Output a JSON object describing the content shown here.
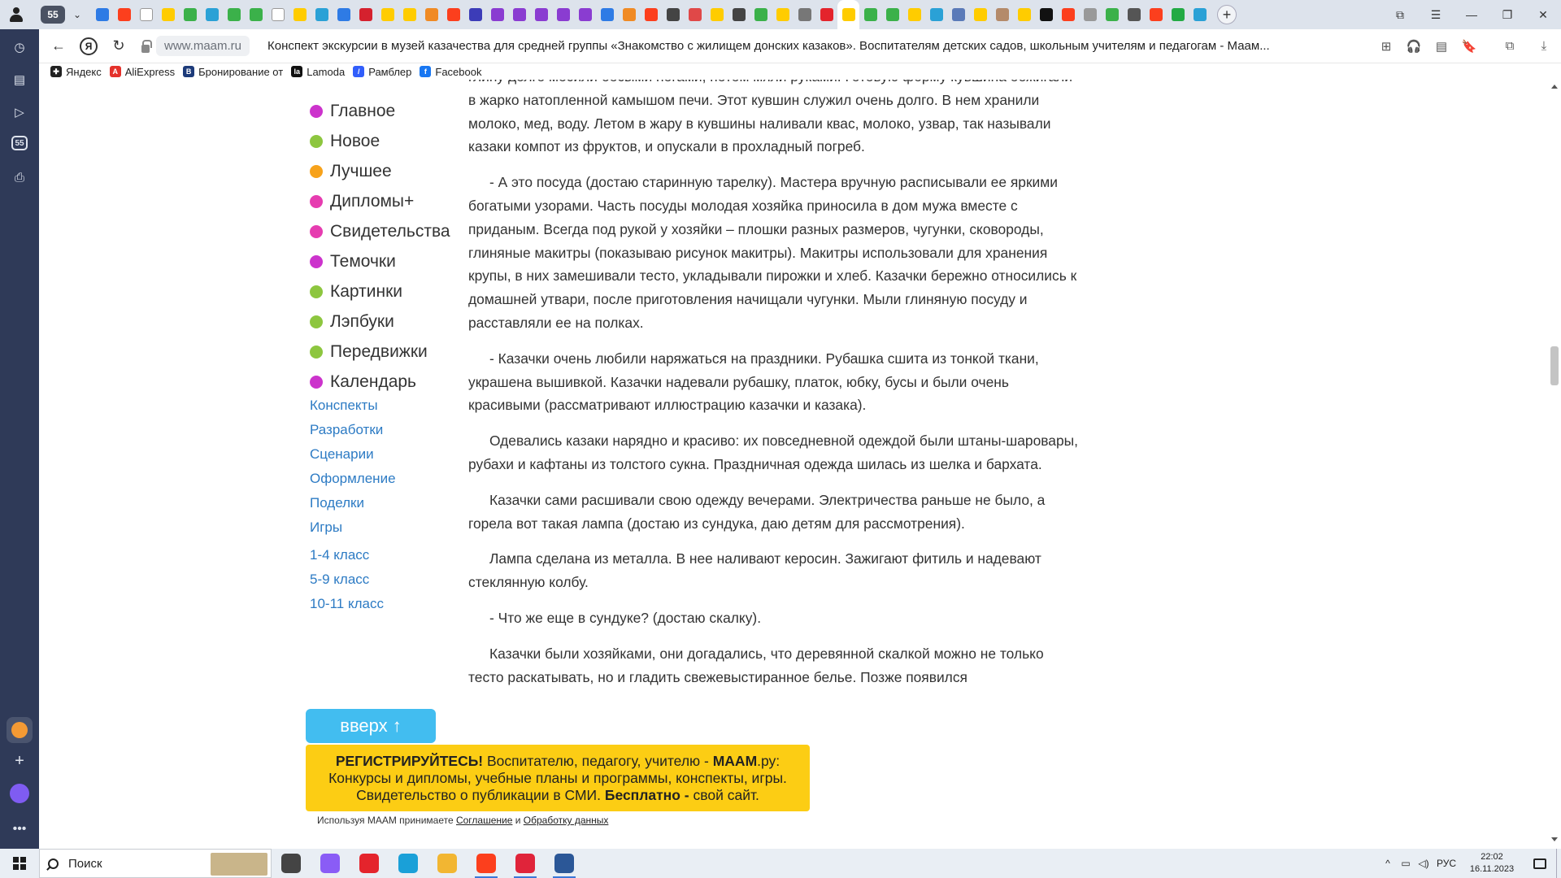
{
  "browser": {
    "tab_count": "55",
    "tabs_dropdown_glyph": "⌄",
    "newtab_glyph": "+",
    "pinned_tab_colors": [
      "#2e7be5",
      "#fc3f1d",
      "#ffffff",
      "#ffcc00",
      "#3bb14a",
      "#2aa1d6",
      "#3bb14a",
      "#3bb14a",
      "#ffffff",
      "#ffcc00",
      "#2aa1d6",
      "#2e7be5",
      "#d5212e",
      "#ffcc00",
      "#ffcc00",
      "#f08a24",
      "#fc3f1d",
      "#3c3cb8",
      "#8a3cd1",
      "#8a3cd1",
      "#8a3cd1",
      "#8a3cd1",
      "#8a3cd1",
      "#2e7be5",
      "#f08a24",
      "#fc3f1d",
      "#444444",
      "#e04848",
      "#ffcc00",
      "#444444",
      "#3bb14a",
      "#ffcc00",
      "#777777",
      "#e4242c",
      "#ffcc00",
      "#3bb14a",
      "#3bb14a",
      "#ffcc00",
      "#2aa1d6",
      "#5a7ab8",
      "#ffcc00",
      "#b48a6a",
      "#ffcc00",
      "#111111",
      "#fc3f1d",
      "#999999",
      "#3bb14a",
      "#555555",
      "#fc3f1d",
      "#22aa44",
      "#2aa1d6"
    ],
    "active_pinned_index": 34,
    "window_controls": [
      "⧉",
      "☰",
      "—",
      "❐",
      "✕"
    ]
  },
  "vsidebar": {
    "icons": [
      "history-icon",
      "notes-icon",
      "play-icon",
      "badge-55-icon",
      "screenshot-icon"
    ],
    "badge_text": "55",
    "bottom_icons": [
      "zen-icon",
      "add-panel-icon",
      "alice-icon",
      "more-icon"
    ]
  },
  "navbar": {
    "back_glyph": "←",
    "ya_glyph": "Я",
    "reload_glyph": "↻",
    "domain": "www.maam.ru",
    "page_title": "Конспект экскурсии в музей казачества для средней группы «Знакомство с жилищем донских казаков». Воспитателям детских садов, школьным учителям и педагогам - Маам...",
    "right_icons": [
      "⊞",
      "🎧",
      "▤",
      "🔖",
      "⧉",
      "⤓"
    ]
  },
  "bookmarks": [
    {
      "label": "Яндекс",
      "color": "#222222",
      "glyph": "✚"
    },
    {
      "label": "AliExpress",
      "color": "#e4312b",
      "glyph": "A"
    },
    {
      "label": "Бронирование от",
      "color": "#1d3b7a",
      "glyph": "B"
    },
    {
      "label": "Lamoda",
      "color": "#111111",
      "glyph": "la"
    },
    {
      "label": "Рамблер",
      "color": "#315efb",
      "glyph": "/"
    },
    {
      "label": "Facebook",
      "color": "#1877f2",
      "glyph": "f"
    }
  ],
  "site_nav": {
    "items": [
      {
        "label": "Главное",
        "color": "#cc33cc"
      },
      {
        "label": "Новое",
        "color": "#8dc63f"
      },
      {
        "label": "Лучшее",
        "color": "#f7a21b"
      },
      {
        "label": "Дипломы+",
        "color": "#e63cb0"
      },
      {
        "label": "Свидетельства",
        "color": "#e63cb0"
      },
      {
        "label": "Темочки",
        "color": "#cc33cc"
      },
      {
        "label": "Картинки",
        "color": "#8dc63f"
      },
      {
        "label": "Лэпбуки",
        "color": "#8dc63f"
      },
      {
        "label": "Передвижки",
        "color": "#8dc63f"
      },
      {
        "label": "Календарь",
        "color": "#cc33cc"
      }
    ],
    "links": [
      "Конспекты",
      "Разработки",
      "Сценарии",
      "Оформление",
      "Поделки",
      "Игры"
    ],
    "grade_links": [
      "1-4 класс",
      "5-9 класс",
      "10-11 класс"
    ]
  },
  "article": {
    "paragraphs": [
      "глину долго месили босыми ногами, потом мяли руками. Готовую форму кувшина обжигали в жарко натопленной камышом печи. Этот кувшин служил очень долго. В нем хранили молоко, мед, воду. Летом в жару в кувшины наливали квас, молоко, узвар, так называли казаки компот из фруктов, и опускали в прохладный погреб.",
      "- А это посуда (достаю старинную тарелку). Мастера вручную расписывали ее яркими богатыми узорами. Часть посуды молодая хозяйка приносила в дом мужа вместе с приданым. Всегда под рукой у хозяйки – плошки разных размеров, чугунки, сковороды, глиняные макитры (показываю рисунок макитры). Макитры использовали для хранения крупы, в них замешивали тесто, укладывали пирожки и хлеб. Казачки бережно относились к домашней утвари, после приготовления начищали чугунки. Мыли глиняную посуду и расставляли ее на полках.",
      "- Казачки очень любили наряжаться на праздники. Рубашка сшита из тонкой ткани, украшена вышивкой. Казачки надевали рубашку, платок, юбку, бусы и были очень красивыми (рассматривают иллюстрацию казачки и казака).",
      "Одевались казаки нарядно и красиво: их повседневной одеждой были штаны-шаровары, рубахи и кафтаны из толстого сукна. Праздничная одежда шилась из шелка и бархата.",
      "Казачки сами расшивали свою одежду вечерами. Электричества раньше не было, а горела вот такая лампа (достаю из сундука, даю детям для рассмотрения).",
      "Лампа сделана из металла. В нее наливают керосин. Зажигают фитиль и надевают стеклянную колбу.",
      "- Что же еще в сундуке? (достаю скалку).",
      "Казачки были хозяйками, они догадались, что деревянной скалкой можно не только тесто раскатывать, но и гладить свежевыстиранное белье. Позже появился"
    ]
  },
  "up_button": {
    "label": "вверх ↑"
  },
  "reg_banner": {
    "line1_bold": "РЕГИСТРИРУЙТЕСЬ!",
    "line1_text": " Воспитателю, педагогу, учителю - ",
    "line1_brand": "МААМ",
    "line1_tail": ".ру:",
    "line2": "Конкурсы и дипломы, учебные планы и программы, конспекты, игры.",
    "line3_text": "Свидетельство о публикации в СМИ. ",
    "line3_bold": "Бесплатно -",
    "line3_tail": " свой сайт."
  },
  "agreement": {
    "prefix": "Используя МААМ принимаете ",
    "link1": "Соглашение",
    "middle": " и ",
    "link2": "Обработку данных"
  },
  "taskbar": {
    "search_placeholder": "Поиск",
    "apps": [
      {
        "name": "task-view-icon",
        "color": "#444444",
        "running": false
      },
      {
        "name": "alice-app-icon",
        "color": "#8a5cf6",
        "running": false
      },
      {
        "name": "opera-icon",
        "color": "#e4242c",
        "running": false
      },
      {
        "name": "edge-icon",
        "color": "#1aa0d8",
        "running": false
      },
      {
        "name": "explorer-icon",
        "color": "#f2b632",
        "running": false
      },
      {
        "name": "yandex-icon",
        "color": "#fc3f1d",
        "running": true
      },
      {
        "name": "yandex-browser-icon",
        "color": "#e0243a",
        "running": true
      },
      {
        "name": "word-icon",
        "color": "#2b5797",
        "running": true
      }
    ],
    "tray": {
      "expand": "^",
      "lang": "РУС",
      "time": "22:02",
      "date": "16.11.2023"
    }
  }
}
